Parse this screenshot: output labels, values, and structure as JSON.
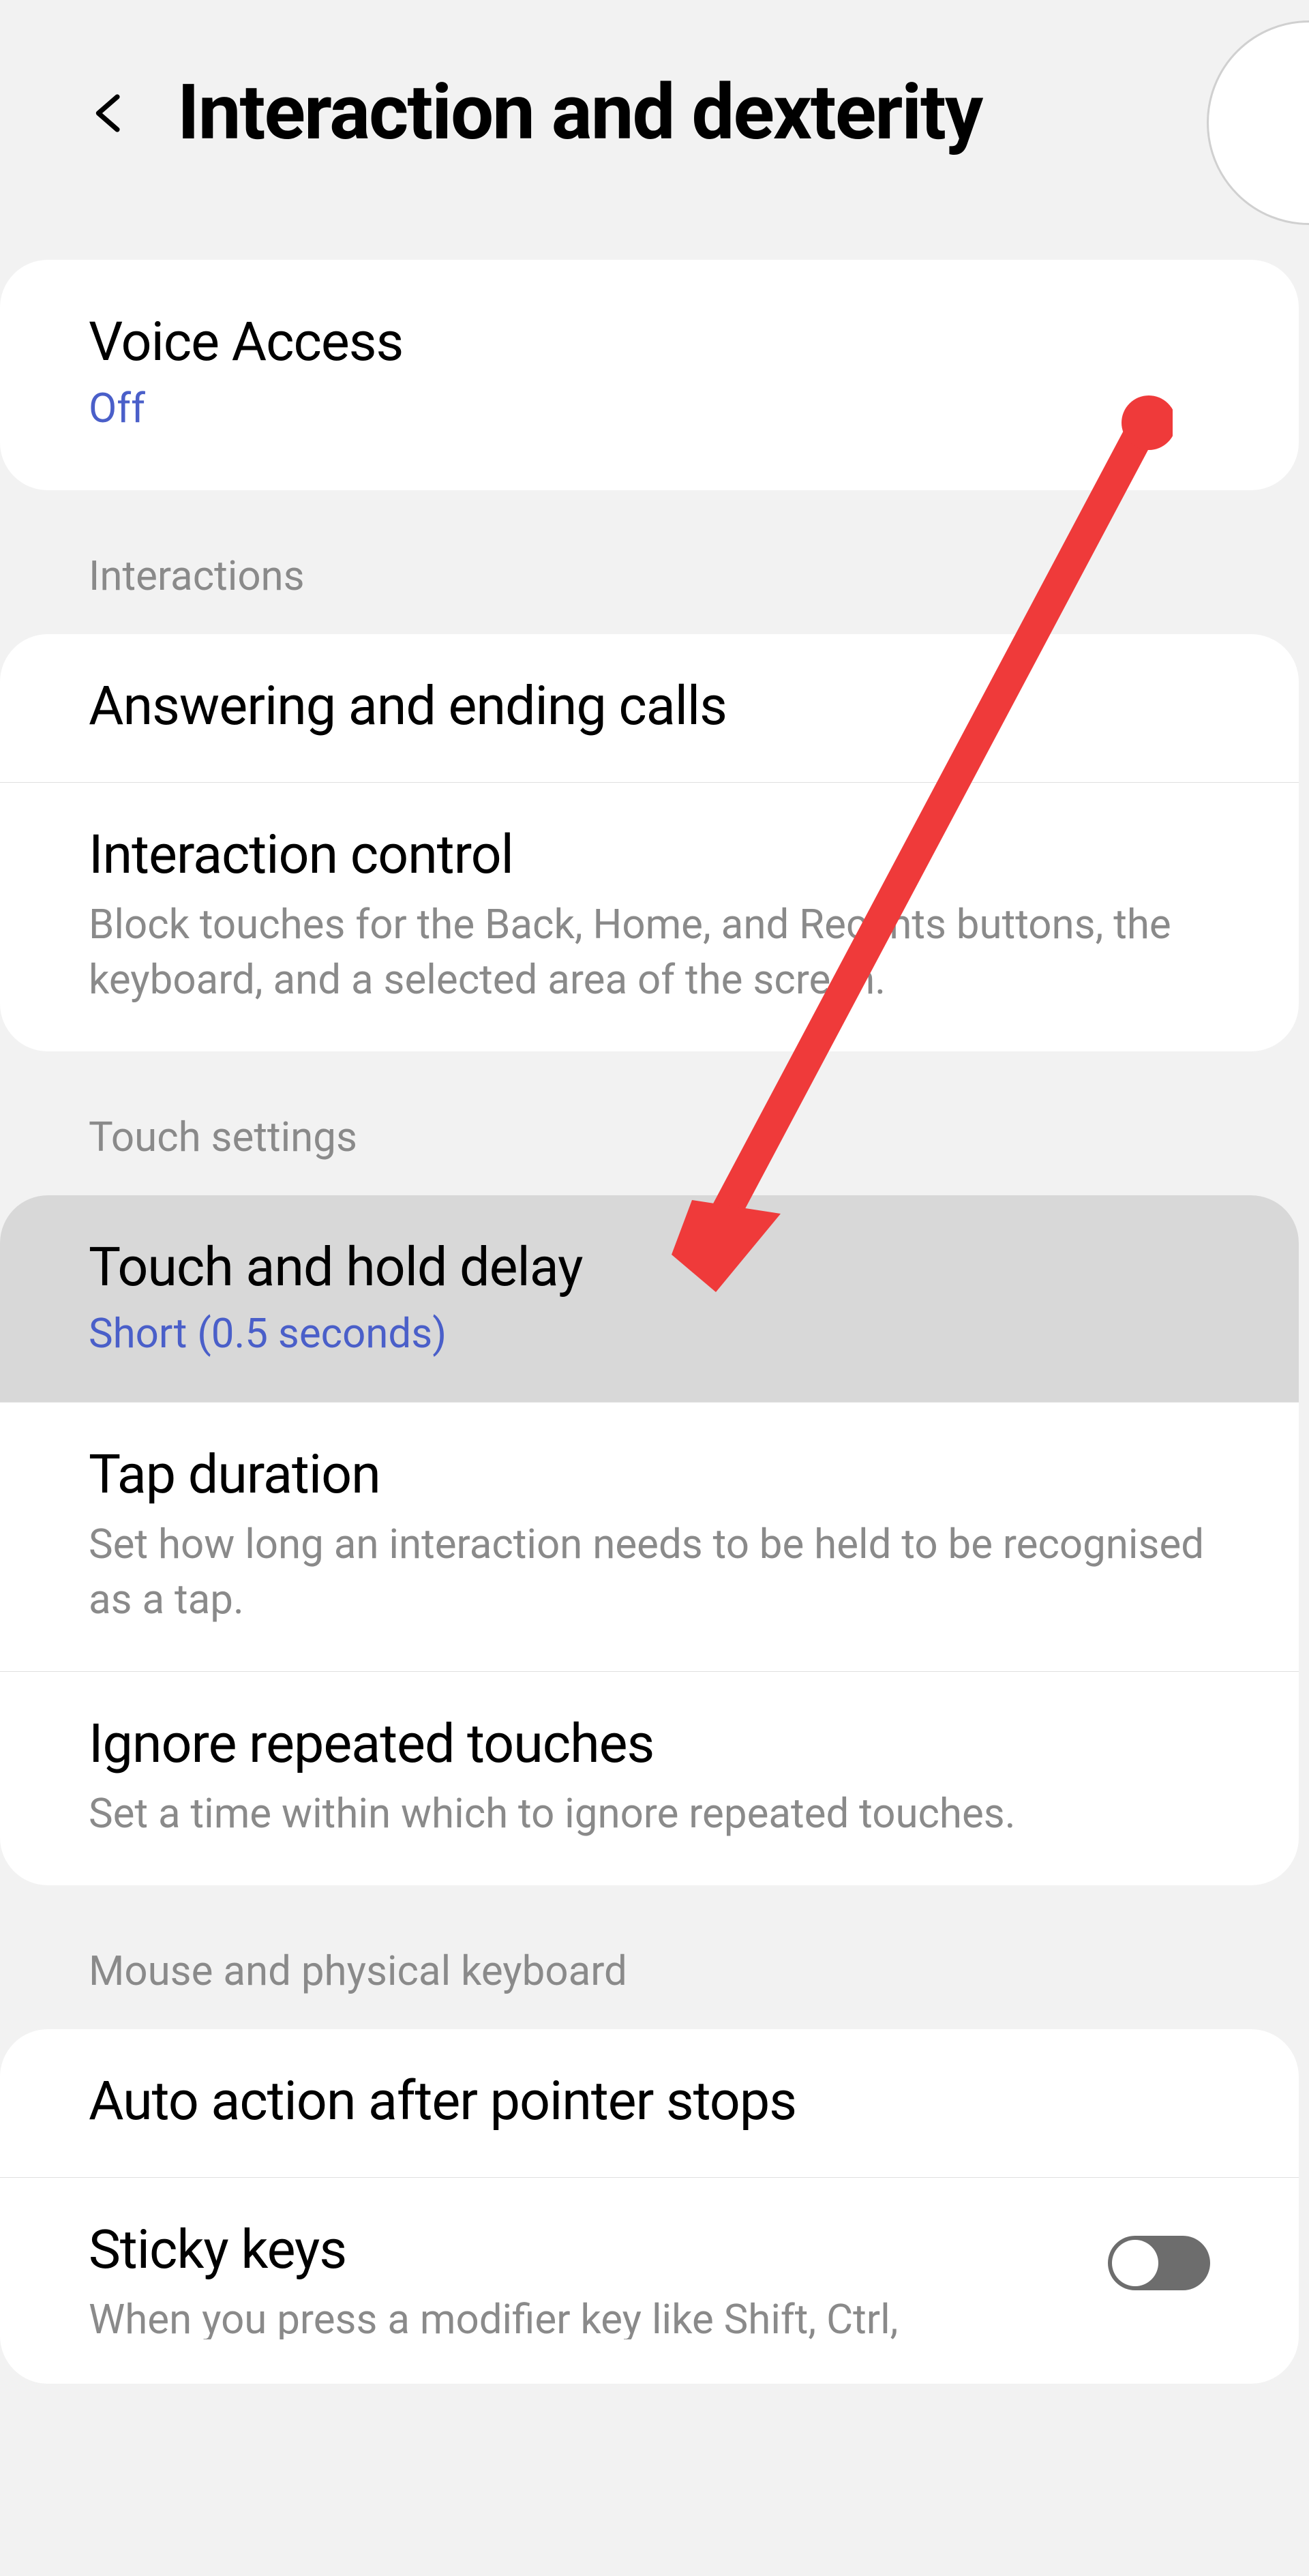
{
  "header": {
    "title": "Interaction and dexterity"
  },
  "voice_access": {
    "title": "Voice Access",
    "status": "Off"
  },
  "sections": {
    "interactions": {
      "header": "Interactions",
      "items": [
        {
          "title": "Answering and ending calls"
        },
        {
          "title": "Interaction control",
          "description": "Block touches for the Back, Home, and Recents buttons, the keyboard, and a selected area of the screen."
        }
      ]
    },
    "touch_settings": {
      "header": "Touch settings",
      "items": [
        {
          "title": "Touch and hold delay",
          "status": "Short (0.5 seconds)"
        },
        {
          "title": "Tap duration",
          "description": "Set how long an interaction needs to be held to be recognised as a tap."
        },
        {
          "title": "Ignore repeated touches",
          "description": "Set a time within which to ignore repeated touches."
        }
      ]
    },
    "mouse_keyboard": {
      "header": "Mouse and physical keyboard",
      "items": [
        {
          "title": "Auto action after pointer stops"
        },
        {
          "title": "Sticky keys",
          "description": "When you press a modifier key like Shift, Ctrl,"
        }
      ]
    }
  },
  "annotation": {
    "arrow_color": "#ef3a3a"
  }
}
